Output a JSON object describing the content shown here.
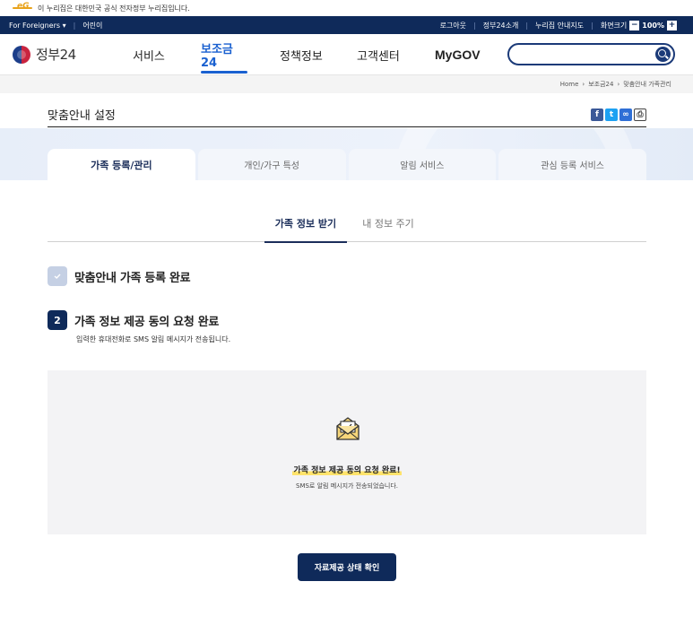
{
  "gov_banner": {
    "text": "이 누리집은 대한민국 공식 전자정부 누리집입니다."
  },
  "util_bar": {
    "for_foreigners": "For Foreigners ▾",
    "kids": "어린이",
    "logout": "로그아웃",
    "about": "정부24소개",
    "sitemap": "누리집 안내지도",
    "screen_size": "화면크기",
    "zoom_minus": "−",
    "zoom_value": "100%",
    "zoom_plus": "+"
  },
  "header": {
    "logo_text": "정부24",
    "nav": [
      "서비스",
      "보조금24",
      "정책정보",
      "고객센터",
      "MyGOV"
    ],
    "active_nav": "보조금24"
  },
  "breadcrumb": [
    "Home",
    "보조금24",
    "맞춤안내 가족관리"
  ],
  "page_title": "맞춤안내 설정",
  "tabs": [
    "가족 등록/관리",
    "개인/가구 특성",
    "알림 서비스",
    "관심 등록 서비스"
  ],
  "subtabs": [
    "가족 정보 받기",
    "내 정보 주기"
  ],
  "steps": {
    "step1": "맞춤안내 가족 등록 완료",
    "step2_number": "2",
    "step2": "가족 정보 제공 동의 요청 완료",
    "step2_desc": "입력한 휴대전화로 SMS 알림 메시지가 전송됩니다."
  },
  "result": {
    "title": "가족 정보 제공 동의 요청 완료!",
    "subtitle": "SMS로 알림 메시지가 전송되었습니다."
  },
  "confirm_button": "자료제공 상태 확인",
  "colors": {
    "navy": "#0f2a5a",
    "accent_blue": "#1960d0",
    "highlight": "#ffe36b"
  }
}
